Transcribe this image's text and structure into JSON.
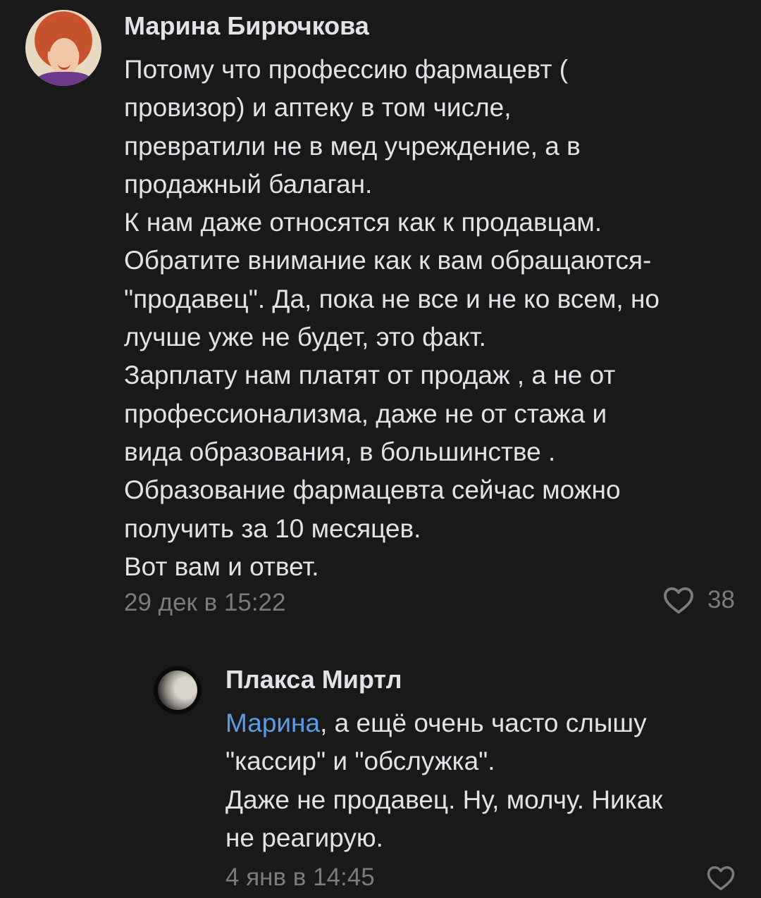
{
  "comments": [
    {
      "author": "Марина Бирючкова",
      "text": "Потому что профессию фармацевт (\nпровизор) и аптеку в том числе,\nпревратили не в мед учреждение, а в\nпродажный балаган.\nК нам даже относятся как к продавцам.\nОбратите внимание как к вам обращаются-\n\"продавец\". Да, пока не все и не ко всем, но\nлучше уже не будет, это факт.\nЗарплату нам платят от продаж , а не от\nпрофессионализма, даже не от стажа и\nвида образования, в большинстве .\nОбразование фармацевта сейчас можно\nполучить за 10 месяцев.\nВот вам и ответ.",
      "date": "29 дек в 15:22",
      "likes": "38",
      "like_icon": "heart-outline-icon"
    },
    {
      "author": "Плакса Миртл",
      "mention": "Марина",
      "text": ", а ещё очень часто слышу\n\"кассир\" и \"обслужка\".\nДаже не продавец. Ну, молчу. Никак\nне реагирую.",
      "date": "4 янв в 14:45",
      "like_icon": "heart-outline-icon"
    }
  ],
  "colors": {
    "background": "#19191a",
    "text": "#e1e3e6",
    "secondary": "#7a7c80",
    "mention": "#5c9ce6"
  }
}
